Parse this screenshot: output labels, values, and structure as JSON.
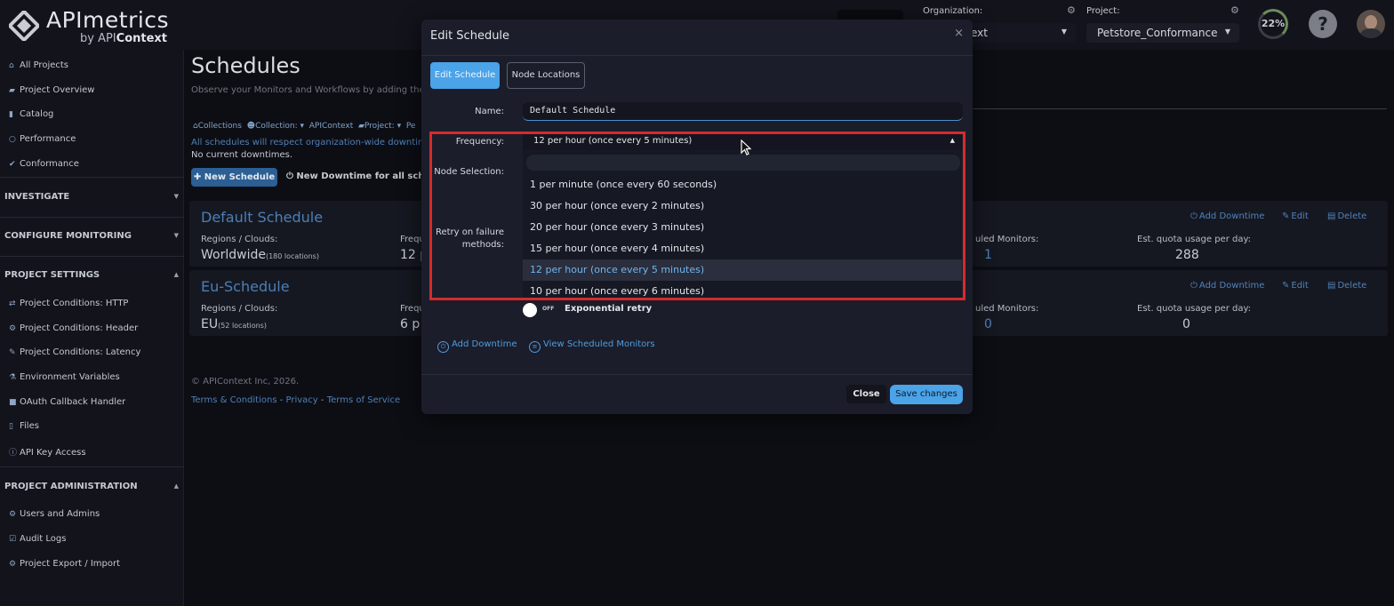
{
  "logo": {
    "title": "APImetrics",
    "sub_prefix": "by API",
    "sub_brand": "Context"
  },
  "topbar": {
    "org_label": "Organization:",
    "org_value": "ext",
    "project_label": "Project:",
    "project_value": "Petstore_Conformance",
    "quota": "22%",
    "help": "?"
  },
  "sidebar": {
    "top_items": [
      {
        "label": "All Projects",
        "icon": "home-icon"
      },
      {
        "label": "Project Overview",
        "icon": "folder-icon"
      },
      {
        "label": "Catalog",
        "icon": "book-icon"
      },
      {
        "label": "Performance",
        "icon": "circle-icon"
      },
      {
        "label": "Conformance",
        "icon": "check-icon"
      }
    ],
    "sections": {
      "investigate": "INVESTIGATE",
      "configure": "CONFIGURE MONITORING",
      "settings": "PROJECT SETTINGS",
      "admin": "PROJECT ADMINISTRATION"
    },
    "settings_items": [
      {
        "label": "Project Conditions: HTTP",
        "icon": "exchange-icon"
      },
      {
        "label": "Project Conditions: Header",
        "icon": "gear-icon"
      },
      {
        "label": "Project Conditions: Latency",
        "icon": "wrench-icon"
      },
      {
        "label": "Environment Variables",
        "icon": "flask-icon"
      },
      {
        "label": "OAuth Callback Handler",
        "icon": "lock-icon"
      },
      {
        "label": "Files",
        "icon": "file-icon"
      },
      {
        "label": "API Key Access",
        "icon": "info-icon"
      }
    ],
    "admin_items": [
      {
        "label": "Users and Admins",
        "icon": "gear-icon"
      },
      {
        "label": "Audit Logs",
        "icon": "check-square-icon"
      },
      {
        "label": "Project Export / Import",
        "icon": "gear-icon"
      }
    ]
  },
  "main": {
    "title": "Schedules",
    "subtitle": "Observe your Monitors and Workflows by adding them to",
    "breadcrumbs": [
      "Collections",
      "Collection:",
      "APIContext",
      "Project:",
      "Pe"
    ],
    "notice_org": "All schedules will respect organization-wide downtimes.",
    "notice_current": "No current downtimes.",
    "new_schedule": "New Schedule",
    "new_downtime": "New Downtime for all schedul",
    "cards": [
      {
        "title": "Default Schedule",
        "regions_label": "Regions / Clouds:",
        "regions_value": "Worldwide",
        "regions_count": "(180 locations)",
        "freq_label": "Frequ",
        "freq_value": "12 p",
        "monitors_label": "uled Monitors:",
        "monitors_value": "1",
        "quota_label": "Est. quota usage per day:",
        "quota_value": "288",
        "add_downtime": "Add Downtime",
        "edit": "Edit",
        "delete": "Delete"
      },
      {
        "title": "Eu-Schedule",
        "regions_label": "Regions / Clouds:",
        "regions_value": "EU",
        "regions_count": "(52 locations)",
        "freq_label": "Frequ",
        "freq_value": "6 p",
        "monitors_label": "uled Monitors:",
        "monitors_value": "0",
        "quota_label": "Est. quota usage per day:",
        "quota_value": "0",
        "add_downtime": "Add Downtime",
        "edit": "Edit",
        "delete": "Delete"
      }
    ],
    "copyright": "© APIContext Inc, 2026.",
    "footer_terms": "Terms & Conditions",
    "footer_privacy": "Privacy",
    "footer_tos": "Terms of Service",
    "footer_sep": " - "
  },
  "modal": {
    "title": "Edit Schedule",
    "close_x": "×",
    "tab_edit": "Edit Schedule",
    "tab_nodes": "Node Locations",
    "name_label": "Name:",
    "name_value": "Default Schedule",
    "frequency_label": "Frequency:",
    "node_selection_label": "Node Selection:",
    "retry_label_1": "Retry on failure",
    "retry_label_2": "methods:",
    "toggle_state": "OFF",
    "exponential_retry": "Exponential retry",
    "add_downtime": "Add Downtime",
    "view_monitors": "View Scheduled Monitors",
    "close": "Close",
    "save": "Save changes"
  },
  "dropdown": {
    "selected": "12 per hour (once every 5 minutes)",
    "options": [
      "1 per minute (once every 60 seconds)",
      "30 per hour (once every 2 minutes)",
      "20 per hour (once every 3 minutes)",
      "15 per hour (once every 4 minutes)",
      "12 per hour (once every 5 minutes)",
      "10 per hour (once every 6 minutes)"
    ]
  },
  "colors": {
    "accent": "#4ba3e8",
    "link": "#4f82bd",
    "highlight": "#d52b2b",
    "background": "#0d0e14"
  }
}
